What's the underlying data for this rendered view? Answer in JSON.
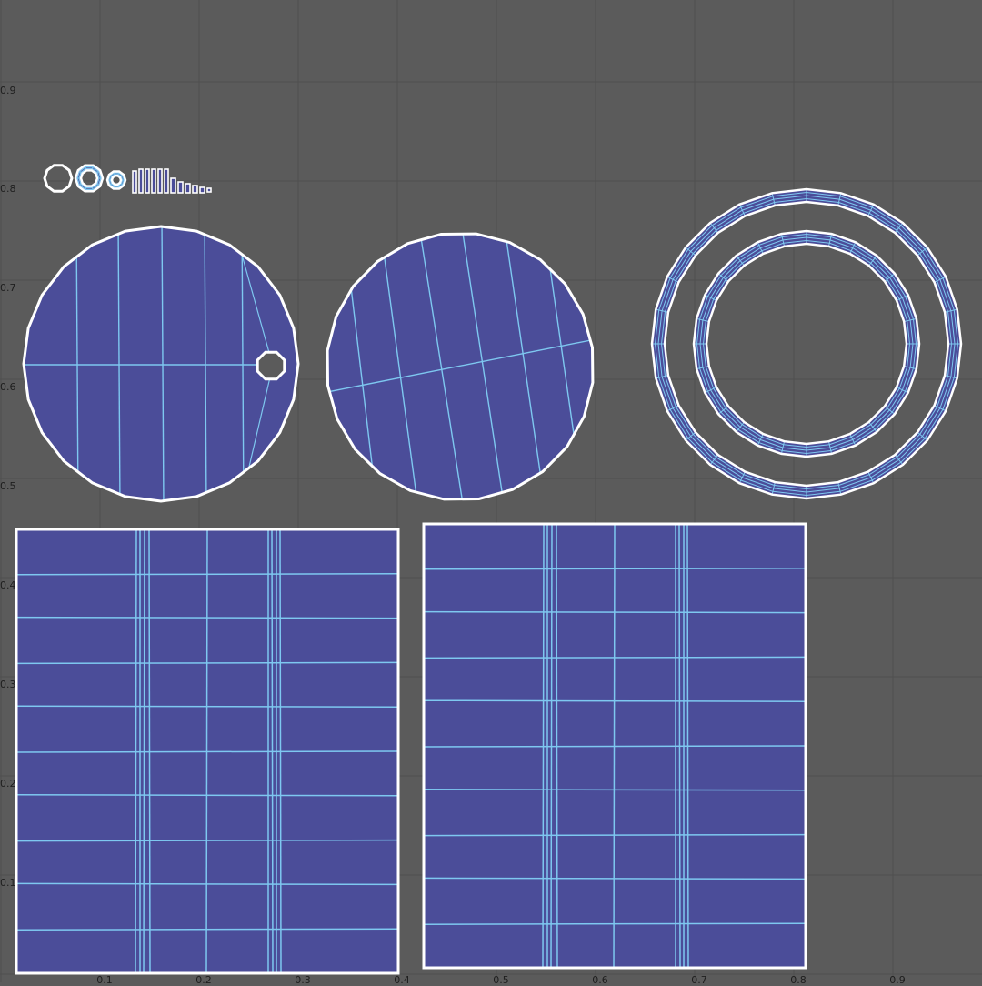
{
  "editor": {
    "name": "UV Editor",
    "background_color": "#5b5b5b",
    "grid_color": "#4f4f4f",
    "face_fill_color": "#4b4d99",
    "edge_color": "#7ec8f0",
    "border_color": "#ffffff"
  },
  "axis": {
    "v_ticks": [
      "0.9",
      "0.8",
      "0.7",
      "0.6",
      "0.5",
      "0.4",
      "0.3",
      "0.2",
      "0.1"
    ],
    "u_ticks": [
      "0.1",
      "0.2",
      "0.3",
      "0.4",
      "0.5",
      "0.6",
      "0.7",
      "0.8",
      "0.9"
    ]
  },
  "uv_shells": [
    {
      "name": "small-circle-shell-1",
      "type": "circle"
    },
    {
      "name": "small-ring-shell",
      "type": "ring"
    },
    {
      "name": "tiny-ring-shell",
      "type": "ring"
    },
    {
      "name": "small-strip-shells",
      "type": "strips"
    },
    {
      "name": "disc-shell-left",
      "type": "disc",
      "hole": true
    },
    {
      "name": "disc-shell-middle",
      "type": "disc",
      "hole": false
    },
    {
      "name": "double-ring-shell",
      "type": "ring"
    },
    {
      "name": "grid-shell-left",
      "type": "grid"
    },
    {
      "name": "grid-shell-right",
      "type": "grid"
    }
  ]
}
